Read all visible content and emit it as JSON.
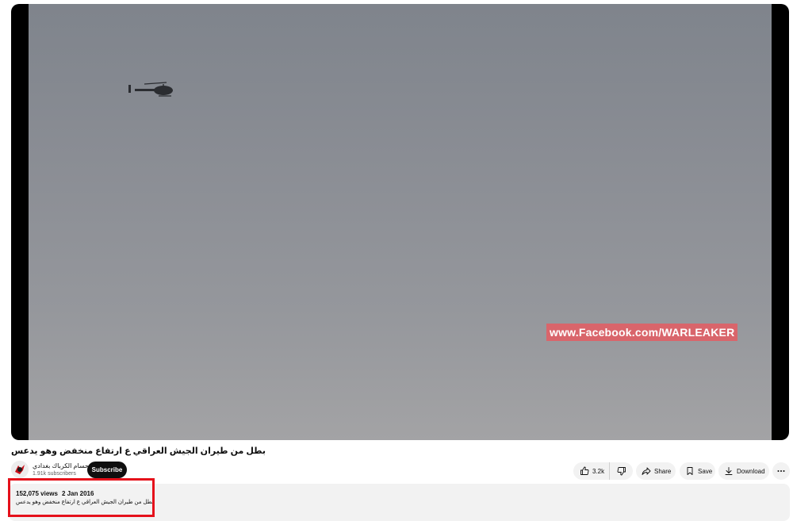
{
  "video": {
    "watermark": "www.Facebook.com/WARLEAKER",
    "title": "بطل من طيران الجيش العراقي ع ارتفاع منخفض وهو يدعس"
  },
  "channel": {
    "name": "حسام الكرباك بغدادي",
    "subscribers": "1.91k subscribers",
    "subscribe_label": "Subscribe"
  },
  "actions": {
    "like_count": "3.2k",
    "share_label": "Share",
    "save_label": "Save",
    "download_label": "Download"
  },
  "description": {
    "views": "152,075 views",
    "date": "2 Jan 2016",
    "text": "بطل من طيران الجيش العراقي ع ارتفاع منخفض وهو يدعس"
  },
  "colors": {
    "highlight_box": "#e5111b",
    "watermark_bg": "#d9656b",
    "subscribe_bg": "#0f0f0f"
  }
}
